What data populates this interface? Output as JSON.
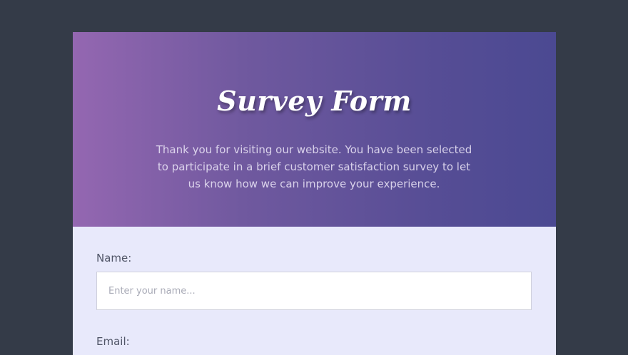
{
  "header": {
    "title": "Survey Form",
    "description": "Thank you for visiting our website. You have been selected to participate in a brief customer satisfaction survey to let us know how we can improve your experience."
  },
  "form": {
    "name_label": "Name:",
    "name_placeholder": "Enter your name...",
    "name_value": "",
    "email_label": "Email:"
  },
  "colors": {
    "page_background": "#343b48",
    "header_gradient_start": "#9467b1",
    "header_gradient_end": "#4b4992",
    "form_background": "#e8e9fb"
  }
}
